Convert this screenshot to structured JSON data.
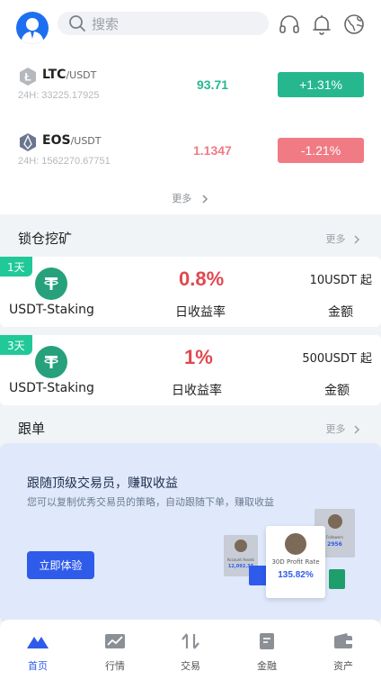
{
  "header": {
    "search_placeholder": "搜索"
  },
  "market": {
    "rows": [
      {
        "symbol": "LTC",
        "pair": "/USDT",
        "volume": "24H: 33225.17925",
        "price": "93.71",
        "change": "+1.31%",
        "direction": "up"
      },
      {
        "symbol": "EOS",
        "pair": "/USDT",
        "volume": "24H: 1562270.67751",
        "price": "1.1347",
        "change": "-1.21%",
        "direction": "down"
      }
    ],
    "more_label": "更多"
  },
  "staking": {
    "title": "锁仓挖矿",
    "more_label": "更多",
    "items": [
      {
        "tag": "1天",
        "name": "USDT-Staking",
        "rate": "0.8%",
        "rate_label": "日收益率",
        "min_amount": "10USDT 起",
        "amount_label": "金额"
      },
      {
        "tag": "3天",
        "name": "USDT-Staking",
        "rate": "1%",
        "rate_label": "日收益率",
        "min_amount": "500USDT 起",
        "amount_label": "金额"
      }
    ]
  },
  "copy_trade": {
    "title": "跟单",
    "more_label": "更多",
    "banner_title": "跟随顶级交易员，赚取收益",
    "banner_desc": "您可以复制优秀交易员的策略，自动跟随下单，赚取收益",
    "cta_label": "立即体验",
    "card_left_label": "Account Assets",
    "card_left_value": "12,092.33",
    "card_right_label": "Followers",
    "card_right_value": "2956",
    "card_main_label": "30D Profit Rate",
    "card_main_value": "135.82%"
  },
  "nav": {
    "items": [
      {
        "label": "首页",
        "icon": "home-mountain-icon",
        "active": true
      },
      {
        "label": "行情",
        "icon": "market-chart-icon",
        "active": false
      },
      {
        "label": "交易",
        "icon": "trade-arrows-icon",
        "active": false
      },
      {
        "label": "金融",
        "icon": "finance-doc-icon",
        "active": false
      },
      {
        "label": "资产",
        "icon": "wallet-icon",
        "active": false
      }
    ]
  },
  "colors": {
    "up": "#26b78f",
    "down": "#f07b84",
    "accent": "#2f5bea",
    "tag": "#20c997",
    "rate": "#e0484f"
  }
}
